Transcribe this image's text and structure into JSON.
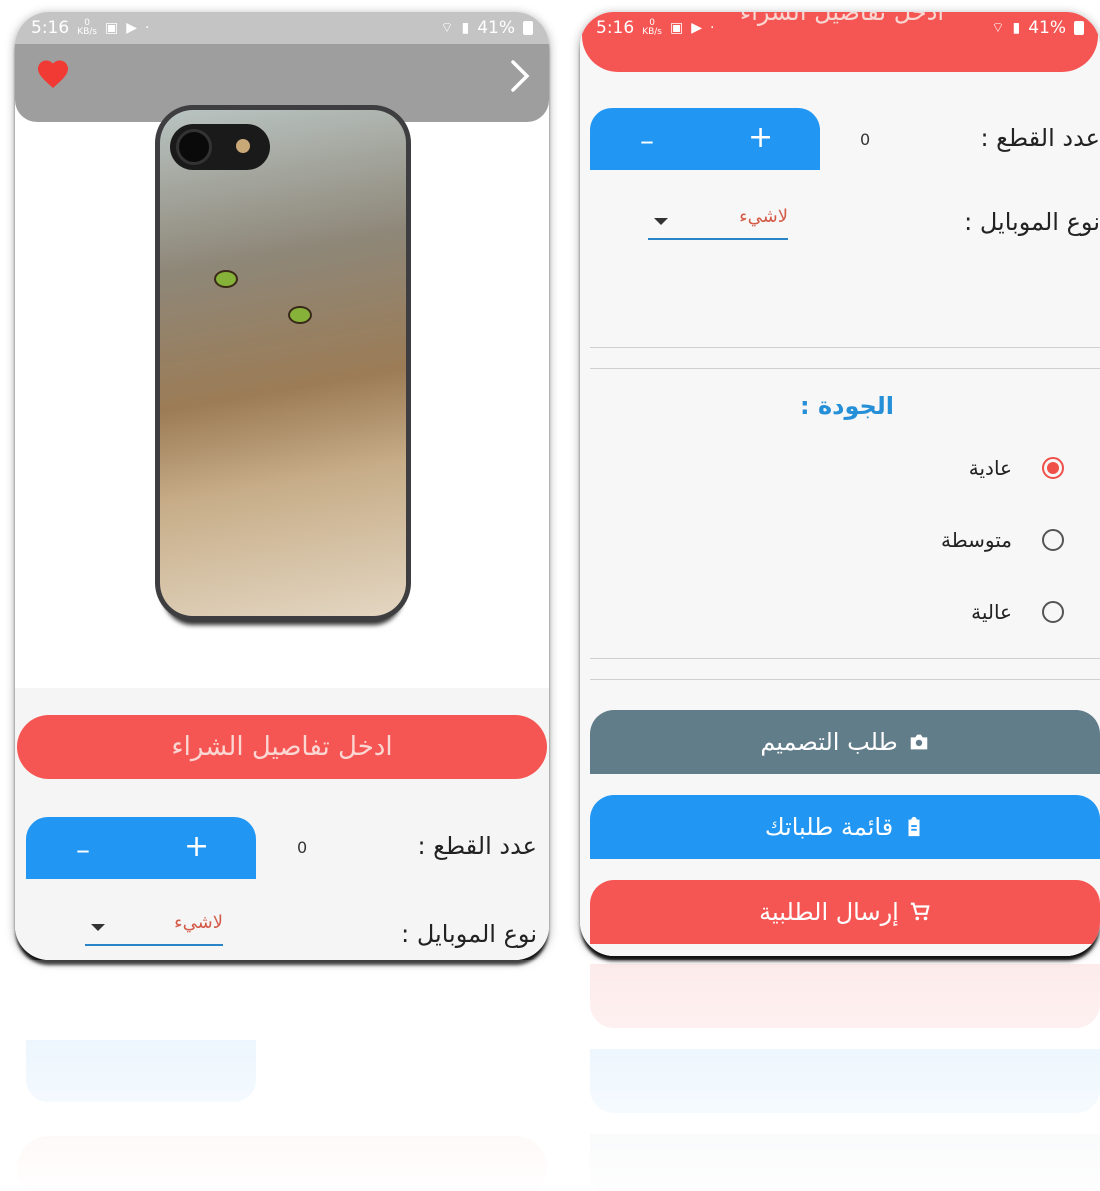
{
  "status_bar": {
    "time": "5:16",
    "kbs_top": "0",
    "kbs_bottom": "KB/s",
    "battery": "41%",
    "dot": "·"
  },
  "left_screen": {
    "purchase_button_label": "ادخل تفاصيل الشراء",
    "quantity_label": "عدد القطع :",
    "quantity_value": "0",
    "minus_label": "–",
    "plus_label": "+",
    "mobile_type_label": "نوع الموبايل :",
    "mobile_type_value": "لاشيء"
  },
  "right_screen": {
    "header_title": "ادخل تفاصيل الشراء",
    "quantity_label": "عدد القطع :",
    "quantity_value": "0",
    "minus_label": "–",
    "plus_label": "+",
    "mobile_type_label": "نوع الموبايل :",
    "mobile_type_value": "لاشيء",
    "quality_title": "الجودة :",
    "quality_options": [
      {
        "label": "عادية",
        "selected": true
      },
      {
        "label": "متوسطة",
        "selected": false
      },
      {
        "label": "عالية",
        "selected": false
      }
    ],
    "buttons": {
      "design_request": "طلب التصميم",
      "my_orders": "قائمة طلباتك",
      "send_order": "إرسال الطلبية"
    }
  },
  "colors": {
    "primary_blue": "#2196f3",
    "accent_red": "#f55553",
    "slate": "#617d8a",
    "appbar_gray": "#9e9e9e"
  },
  "icons": [
    "heart-icon",
    "chevron-right-icon",
    "wifi-icon",
    "signal-icon",
    "battery-icon",
    "gallery-icon",
    "play-store-icon",
    "camera-bag-icon",
    "clipboard-icon",
    "cart-icon"
  ]
}
